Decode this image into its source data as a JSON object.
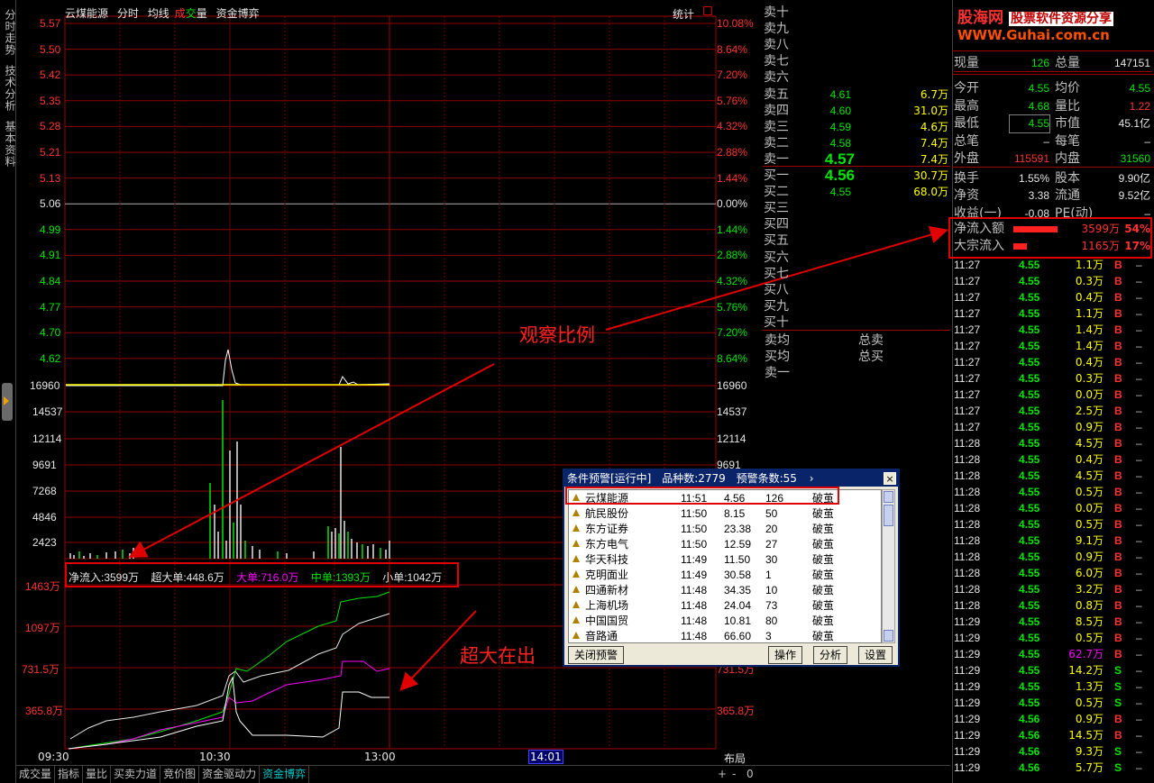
{
  "side_tabs": [
    "分时走势",
    "技术分析",
    "基本资料"
  ],
  "chart_header": {
    "stock": "云煤能源",
    "items": [
      "分时",
      "均线"
    ],
    "vol_a": "成",
    "vol_b": "交",
    "vol_c": "量",
    "fund": "资金博弈",
    "stat": "统计"
  },
  "price_axis": {
    "left": [
      "5.57",
      "5.50",
      "5.42",
      "5.35",
      "5.28",
      "5.21",
      "5.13",
      "5.06",
      "4.99",
      "4.91",
      "4.84",
      "4.77",
      "4.70",
      "4.62"
    ],
    "right": [
      "10.08%",
      "8.64%",
      "7.20%",
      "5.76%",
      "4.32%",
      "2.88%",
      "1.44%",
      "0.00%",
      "1.44%",
      "2.88%",
      "4.32%",
      "5.76%",
      "7.20%",
      "8.64%"
    ]
  },
  "volume_axis": [
    "16960",
    "14537",
    "12114",
    "9691",
    "7268",
    "4846",
    "2423"
  ],
  "flow_axis": [
    "1463万",
    "1097万",
    "731.5万",
    "365.8万"
  ],
  "time_axis": [
    "09:30",
    "10:30",
    "13:00",
    "14:01"
  ],
  "layout_label": "布局",
  "flow_legend": {
    "net": "净流入:3599万",
    "super": "超大单:448.6万",
    "big": "大单:716.0万",
    "mid": "中单:1393万",
    "small": "小单:1042万"
  },
  "annotations": {
    "ratio": "观察比例",
    "super_out": "超大在出"
  },
  "orderbook": [
    {
      "label": "卖十",
      "price": "",
      "vol": ""
    },
    {
      "label": "卖九",
      "price": "",
      "vol": ""
    },
    {
      "label": "卖八",
      "price": "",
      "vol": ""
    },
    {
      "label": "卖七",
      "price": "",
      "vol": ""
    },
    {
      "label": "卖六",
      "price": "",
      "vol": ""
    },
    {
      "label": "卖五",
      "price": "4.61",
      "vol": "6.7万"
    },
    {
      "label": "卖四",
      "price": "4.60",
      "vol": "31.0万"
    },
    {
      "label": "卖三",
      "price": "4.59",
      "vol": "4.6万"
    },
    {
      "label": "卖二",
      "price": "4.58",
      "vol": "7.4万"
    },
    {
      "label": "卖一",
      "price": "4.57",
      "vol": "7.4万"
    },
    {
      "label": "买一",
      "price": "4.56",
      "vol": "30.7万"
    },
    {
      "label": "买二",
      "price": "4.55",
      "vol": "68.0万"
    },
    {
      "label": "买三",
      "price": "",
      "vol": ""
    },
    {
      "label": "买四",
      "price": "",
      "vol": ""
    },
    {
      "label": "买五",
      "price": "",
      "vol": ""
    },
    {
      "label": "买六",
      "price": "",
      "vol": ""
    },
    {
      "label": "买七",
      "price": "",
      "vol": ""
    },
    {
      "label": "买八",
      "price": "",
      "vol": ""
    },
    {
      "label": "买九",
      "price": "",
      "vol": ""
    },
    {
      "label": "买十",
      "price": "",
      "vol": ""
    }
  ],
  "ob_summary": {
    "sell_avg": "卖均",
    "buy_avg": "买均",
    "total_sell": "总卖",
    "total_buy": "总买",
    "sell1": "卖一"
  },
  "logo": {
    "a": "股海网",
    "b": "股票软件资源分享",
    "url": "WWW.Guhai.com.cn"
  },
  "quote": [
    {
      "a": "现量",
      "b": "126",
      "c": "总量",
      "d": "147151",
      "bc": "#00e600",
      "dc": "#e6e6e6"
    },
    {
      "a": "今开",
      "b": "4.55",
      "c": "均价",
      "d": "4.55",
      "bc": "#00e600",
      "dc": "#00e600"
    },
    {
      "a": "最高",
      "b": "4.68",
      "c": "量比",
      "d": "1.22",
      "bc": "#00e600",
      "dc": "#ff3232"
    },
    {
      "a": "最低",
      "b": "4.55",
      "c": "市值",
      "d": "45.1亿",
      "bc": "#00e600",
      "dc": "#e6e6e6"
    },
    {
      "a": "总笔",
      "b": "–",
      "c": "每笔",
      "d": "–",
      "bc": "#e6e6e6",
      "dc": "#e6e6e6"
    },
    {
      "a": "外盘",
      "b": "115591",
      "c": "内盘",
      "d": "31560",
      "bc": "#ff3232",
      "dc": "#00e600"
    },
    {
      "a": "换手",
      "b": "1.55%",
      "c": "股本",
      "d": "9.90亿",
      "bc": "#e6e6e6",
      "dc": "#e6e6e6"
    },
    {
      "a": "净资",
      "b": "3.38",
      "c": "流通",
      "d": "9.52亿",
      "bc": "#e6e6e6",
      "dc": "#e6e6e6"
    },
    {
      "a": "收益(一)",
      "b": "-0.08",
      "c": "PE(动)",
      "d": "–",
      "bc": "#e6e6e6",
      "dc": "#e6e6e6"
    }
  ],
  "flows": [
    {
      "label": "净流入额",
      "value": "3599万",
      "pct": "54%",
      "bar": 0.54
    },
    {
      "label": "大宗流入",
      "value": "1165万",
      "pct": "17%",
      "bar": 0.17
    }
  ],
  "ticks": [
    {
      "t": "11:27",
      "p": "4.55",
      "v": "1.1万",
      "s": "B",
      "n": "–"
    },
    {
      "t": "11:27",
      "p": "4.55",
      "v": "0.3万",
      "s": "B",
      "n": "–"
    },
    {
      "t": "11:27",
      "p": "4.55",
      "v": "0.4万",
      "s": "B",
      "n": "–"
    },
    {
      "t": "11:27",
      "p": "4.55",
      "v": "1.1万",
      "s": "B",
      "n": "–"
    },
    {
      "t": "11:27",
      "p": "4.55",
      "v": "1.4万",
      "s": "B",
      "n": "–"
    },
    {
      "t": "11:27",
      "p": "4.55",
      "v": "1.4万",
      "s": "B",
      "n": "–"
    },
    {
      "t": "11:27",
      "p": "4.55",
      "v": "0.4万",
      "s": "B",
      "n": "–"
    },
    {
      "t": "11:27",
      "p": "4.55",
      "v": "0.3万",
      "s": "B",
      "n": "–"
    },
    {
      "t": "11:27",
      "p": "4.55",
      "v": "0.0万",
      "s": "B",
      "n": "–"
    },
    {
      "t": "11:27",
      "p": "4.55",
      "v": "2.5万",
      "s": "B",
      "n": "–"
    },
    {
      "t": "11:27",
      "p": "4.55",
      "v": "0.9万",
      "s": "B",
      "n": "–"
    },
    {
      "t": "11:28",
      "p": "4.55",
      "v": "4.5万",
      "s": "B",
      "n": "–"
    },
    {
      "t": "11:28",
      "p": "4.55",
      "v": "0.4万",
      "s": "B",
      "n": "–"
    },
    {
      "t": "11:28",
      "p": "4.55",
      "v": "4.5万",
      "s": "B",
      "n": "–"
    },
    {
      "t": "11:28",
      "p": "4.55",
      "v": "0.5万",
      "s": "B",
      "n": "–"
    },
    {
      "t": "11:28",
      "p": "4.55",
      "v": "0.0万",
      "s": "B",
      "n": "–"
    },
    {
      "t": "11:28",
      "p": "4.55",
      "v": "0.5万",
      "s": "B",
      "n": "–"
    },
    {
      "t": "11:28",
      "p": "4.55",
      "v": "9.1万",
      "s": "B",
      "n": "–"
    },
    {
      "t": "11:28",
      "p": "4.55",
      "v": "0.9万",
      "s": "B",
      "n": "–"
    },
    {
      "t": "11:28",
      "p": "4.55",
      "v": "6.0万",
      "s": "B",
      "n": "–"
    },
    {
      "t": "11:28",
      "p": "4.55",
      "v": "3.2万",
      "s": "B",
      "n": "–"
    },
    {
      "t": "11:28",
      "p": "4.55",
      "v": "0.8万",
      "s": "B",
      "n": "–"
    },
    {
      "t": "11:29",
      "p": "4.55",
      "v": "8.5万",
      "s": "B",
      "n": "–"
    },
    {
      "t": "11:29",
      "p": "4.55",
      "v": "0.5万",
      "s": "B",
      "n": "–"
    },
    {
      "t": "11:29",
      "p": "4.55",
      "v": "62.7万",
      "s": "B",
      "n": "–"
    },
    {
      "t": "11:29",
      "p": "4.55",
      "v": "14.2万",
      "s": "S",
      "n": "–"
    },
    {
      "t": "11:29",
      "p": "4.55",
      "v": "1.3万",
      "s": "S",
      "n": "–"
    },
    {
      "t": "11:29",
      "p": "4.55",
      "v": "0.5万",
      "s": "S",
      "n": "–"
    },
    {
      "t": "11:29",
      "p": "4.56",
      "v": "0.9万",
      "s": "B",
      "n": "–"
    },
    {
      "t": "11:29",
      "p": "4.56",
      "v": "14.5万",
      "s": "B",
      "n": "–"
    },
    {
      "t": "11:29",
      "p": "4.56",
      "v": "9.3万",
      "s": "S",
      "n": "–"
    },
    {
      "t": "11:29",
      "p": "4.56",
      "v": "5.7万",
      "s": "S",
      "n": "–"
    }
  ],
  "bottom_tabs": [
    "成交量",
    "指标",
    "量比",
    "买卖力道",
    "竞价图",
    "资金驱动力",
    "资金博弈"
  ],
  "bottom_right": [
    "+",
    "-",
    "0"
  ],
  "alert_window": {
    "title": "条件预警[运行中]",
    "count": "品种数:2779",
    "alerts": "预警条数:55",
    "close": "×",
    "rows": [
      {
        "name": "云煤能源",
        "time": "11:51",
        "price": "4.56",
        "vol": "126",
        "cond": "破茧"
      },
      {
        "name": "航民股份",
        "time": "11:50",
        "price": "8.15",
        "vol": "50",
        "cond": "破茧"
      },
      {
        "name": "东方证券",
        "time": "11:50",
        "price": "23.38",
        "vol": "20",
        "cond": "破茧"
      },
      {
        "name": "东方电气",
        "time": "11:50",
        "price": "12.59",
        "vol": "27",
        "cond": "破茧"
      },
      {
        "name": "华天科技",
        "time": "11:49",
        "price": "11.50",
        "vol": "30",
        "cond": "破茧"
      },
      {
        "name": "克明面业",
        "time": "11:49",
        "price": "30.58",
        "vol": "1",
        "cond": "破茧"
      },
      {
        "name": "四通新材",
        "time": "11:48",
        "price": "34.35",
        "vol": "10",
        "cond": "破茧"
      },
      {
        "name": "上海机场",
        "time": "11:48",
        "price": "24.04",
        "vol": "73",
        "cond": "破茧"
      },
      {
        "name": "中国国贸",
        "time": "11:48",
        "price": "10.81",
        "vol": "80",
        "cond": "破茧"
      },
      {
        "name": "音路通",
        "time": "11:48",
        "price": "66.60",
        "vol": "3",
        "cond": "破茧"
      }
    ],
    "btn_close": "关闭预警",
    "btn_op": "操作",
    "btn_analyze": "分析",
    "btn_settings": "设置"
  }
}
